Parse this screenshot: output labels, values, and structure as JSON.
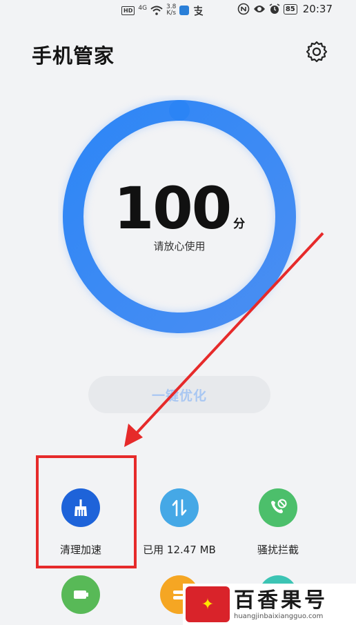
{
  "status_bar": {
    "hd": "HD",
    "signal": "4G",
    "speed_value": "3.8",
    "speed_unit": "K/s",
    "battery": "85",
    "time": "20:37"
  },
  "header": {
    "title": "手机管家"
  },
  "score": {
    "value": "100",
    "unit": "分",
    "subtitle": "请放心使用"
  },
  "optimize_button": {
    "label": "一键优化"
  },
  "tools": [
    {
      "label": "清理加速",
      "color": "#1e63d9",
      "icon": "broom-icon"
    },
    {
      "label": "已用 12.47 MB",
      "color": "#45a8e6",
      "icon": "data-transfer-icon"
    },
    {
      "label": "骚扰拦截",
      "color": "#4cbf6b",
      "icon": "blocked-call-icon"
    }
  ],
  "tools_row2": [
    {
      "color": "#58b957",
      "icon": "battery-icon"
    },
    {
      "color": "#f5a623",
      "icon": "app-lock-icon"
    },
    {
      "color": "#3cc4b4",
      "icon": "security-icon"
    }
  ],
  "watermark": {
    "cn": "百香果号",
    "url": "huangjinbaixiangguo.com"
  },
  "colors": {
    "ring_start": "#2f8bf6",
    "ring_end": "#4d8cf0",
    "highlight": "#e62a2a"
  }
}
